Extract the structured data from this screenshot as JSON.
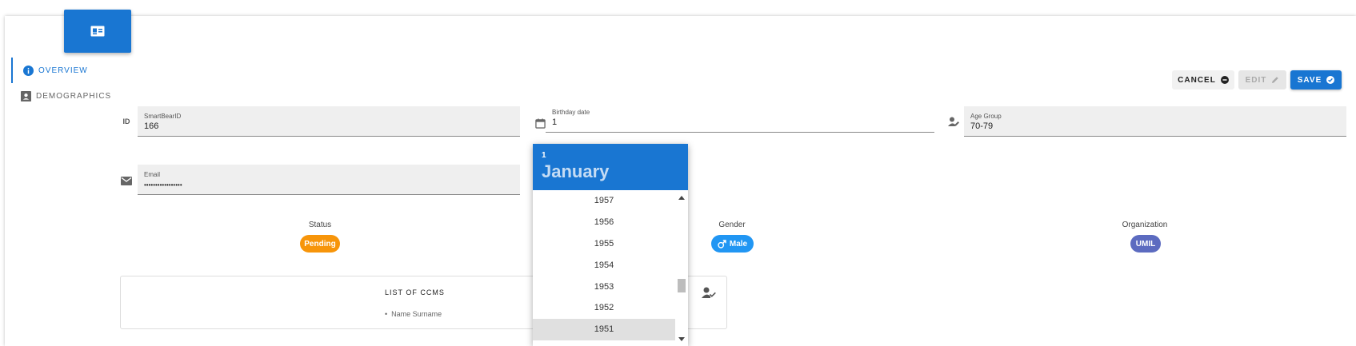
{
  "nav": {
    "items": [
      {
        "label": "OVERVIEW",
        "icon": "info-icon",
        "active": true
      },
      {
        "label": "DEMOGRAPHICS",
        "icon": "contact-card-icon",
        "active": false
      }
    ]
  },
  "toolbar": {
    "cancel_label": "CANCEL",
    "edit_label": "EDIT",
    "save_label": "SAVE"
  },
  "fields": {
    "smartbear_id": {
      "label": "SmartBearID",
      "value": "166",
      "icon_text": "ID"
    },
    "birthday": {
      "label": "Birthday date",
      "value": "1"
    },
    "age_group": {
      "label": "Age Group",
      "value": "70-79"
    },
    "email": {
      "label": "Email",
      "value": "•••••••••••••••••"
    }
  },
  "status": {
    "label": "Status",
    "value": "Pending",
    "color": "#f7950a"
  },
  "gender": {
    "label": "Gender",
    "value": "Male",
    "color": "#2196f3"
  },
  "organization": {
    "label": "Organization",
    "value": "UMIL",
    "color": "#5c6bc0"
  },
  "ccms": {
    "title": "LIST OF CCMS",
    "items": [
      "Name Surname"
    ]
  },
  "date_picker": {
    "day": "1",
    "month": "January",
    "years": [
      "1957",
      "1956",
      "1955",
      "1954",
      "1953",
      "1952",
      "1951"
    ],
    "selected_year": "1951"
  },
  "colors": {
    "accent": "#1976d2"
  }
}
